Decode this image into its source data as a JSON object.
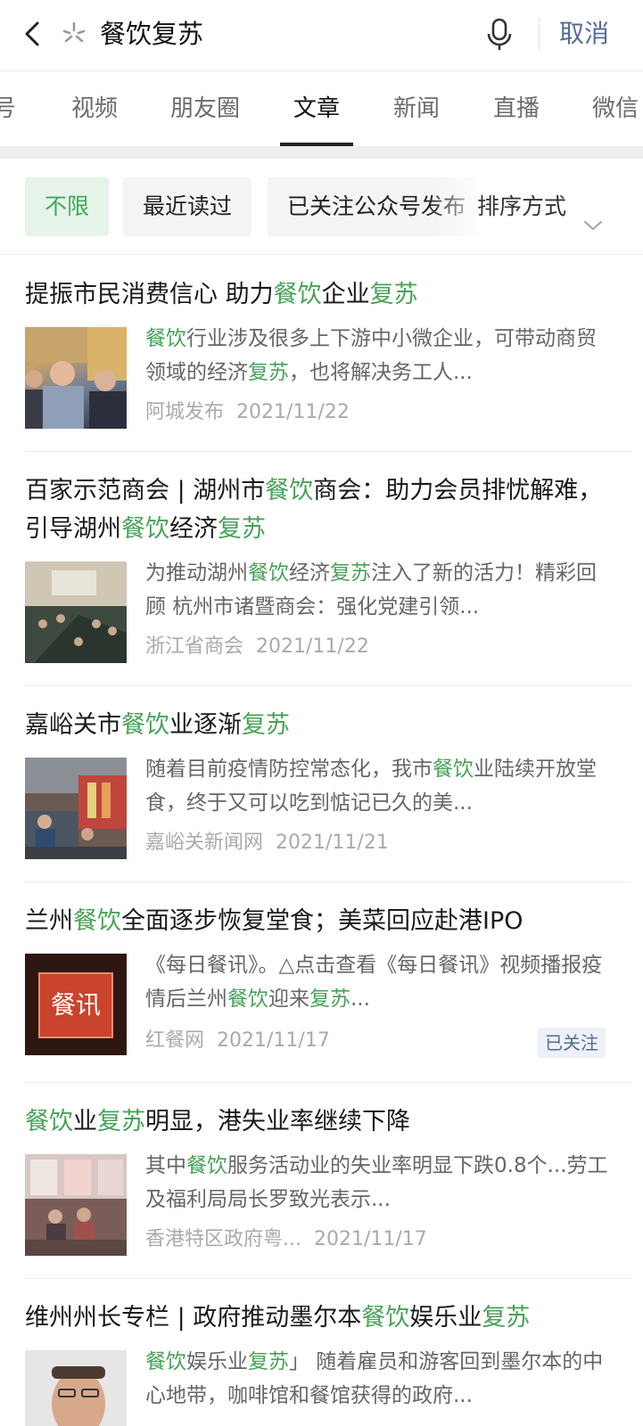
{
  "search": {
    "query": "餐饮复苏",
    "cancel_label": "取消"
  },
  "tabs": [
    "号",
    "视频",
    "朋友圈",
    "文章",
    "新闻",
    "直播",
    "微信"
  ],
  "active_tab": "文章",
  "filters": {
    "chips": [
      "不限",
      "最近读过",
      "已关注公众号发布"
    ],
    "sort_label": "排序方式"
  },
  "colors": {
    "highlight": "#48a257",
    "link": "#576b95",
    "active_chip_bg": "#e6f3e9"
  },
  "results": [
    {
      "title": [
        [
          "提振市民消费信心 助力",
          false
        ],
        [
          "餐饮",
          true
        ],
        [
          "企业",
          false
        ],
        [
          "复苏",
          true
        ]
      ],
      "summary": [
        [
          "餐饮",
          true
        ],
        [
          "行业涉及很多上下游中小微企业，可带动商贸领域的经济",
          false
        ],
        [
          "复苏",
          true
        ],
        [
          "，也将解决务工人...",
          false
        ]
      ],
      "source": "阿城发布",
      "date": "2021/11/22",
      "badge": ""
    },
    {
      "title": [
        [
          "百家示范商会 | 湖州市",
          false
        ],
        [
          "餐饮",
          true
        ],
        [
          "商会：助力会员排忧解难，引导湖州",
          false
        ],
        [
          "餐饮",
          true
        ],
        [
          "经济",
          false
        ],
        [
          "复苏",
          true
        ]
      ],
      "summary": [
        [
          "为推动湖州",
          false
        ],
        [
          "餐饮",
          true
        ],
        [
          "经济",
          false
        ],
        [
          "复苏",
          true
        ],
        [
          "注入了新的活力！精彩回顾 杭州市诸暨商会：强化党建引领...",
          false
        ]
      ],
      "source": "浙江省商会",
      "date": "2021/11/22",
      "badge": ""
    },
    {
      "title": [
        [
          "嘉峪关市",
          false
        ],
        [
          "餐饮",
          true
        ],
        [
          "业逐渐",
          false
        ],
        [
          "复苏",
          true
        ]
      ],
      "summary": [
        [
          "随着目前疫情防控常态化，我市",
          false
        ],
        [
          "餐饮",
          true
        ],
        [
          "业陆续开放堂食，终于又可以吃到惦记已久的美...",
          false
        ]
      ],
      "source": "嘉峪关新闻网",
      "date": "2021/11/21",
      "badge": ""
    },
    {
      "title": [
        [
          "兰州",
          false
        ],
        [
          "餐饮",
          true
        ],
        [
          "全面逐步恢复堂食；美菜回应赴港IPO",
          false
        ]
      ],
      "summary": [
        [
          "《每日餐讯》。△点击查看《每日餐讯》视频播报疫情后兰州",
          false
        ],
        [
          "餐饮",
          true
        ],
        [
          "迎来",
          false
        ],
        [
          "复苏",
          true
        ],
        [
          "...",
          false
        ]
      ],
      "source": "红餐网",
      "date": "2021/11/17",
      "badge": "已关注",
      "thumb_text": "餐讯"
    },
    {
      "title": [
        [
          "餐饮",
          true
        ],
        [
          "业",
          false
        ],
        [
          "复苏",
          true
        ],
        [
          "明显，港失业率继续下降",
          false
        ]
      ],
      "summary": [
        [
          "其中",
          false
        ],
        [
          "餐饮",
          true
        ],
        [
          "服务活动业的失业率明显下跌0.8个...劳工及福利局局长罗致光表示...",
          false
        ]
      ],
      "source": "香港特区政府粤...",
      "date": "2021/11/17",
      "badge": ""
    },
    {
      "title": [
        [
          "维州州长专栏 | 政府推动墨尔本",
          false
        ],
        [
          "餐饮",
          true
        ],
        [
          "娱乐业",
          false
        ],
        [
          "复苏",
          true
        ]
      ],
      "summary": [
        [
          "餐饮",
          true
        ],
        [
          "娱乐业",
          false
        ],
        [
          "复苏",
          true
        ],
        [
          "」 随着雇员和游客回到墨尔本的中心地带，咖啡馆和餐馆获得的政府...",
          false
        ]
      ],
      "source": "",
      "date": "",
      "badge": ""
    }
  ]
}
